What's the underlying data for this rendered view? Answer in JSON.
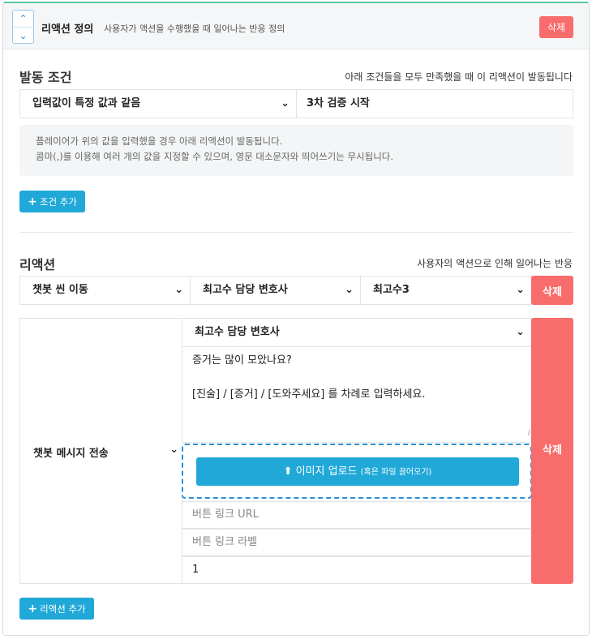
{
  "header": {
    "title": "리액션 정의",
    "description": "사용자가 액션을 수행했을 때 일어나는 반응 정의",
    "delete_label": "삭제"
  },
  "condition": {
    "title": "발동 조건",
    "note": "아래 조건들을 모두 만족했을 때 이 리액션이 발동됩니다",
    "type_select": "입력값이 특정 값과 같음",
    "value_input": "3차 검증 시작",
    "info_line1": "플레이어가 위의 값을 입력했을 경우 아래 리액션이 발동됩니다.",
    "info_line2": "콤마(,)를 이용해 여러 개의 값을 지정할 수 있으며, 영문 대소문자와 띄어쓰기는 무시됩니다.",
    "add_label": "조건 추가"
  },
  "reaction": {
    "title": "리액션",
    "note": "사용자의 액션으로 인해 일어나는 반응",
    "row1": {
      "type": "챗봇 씬 이동",
      "target": "최고수 담당 변호사",
      "scene": "최고수3",
      "delete_label": "삭제"
    },
    "row2": {
      "type": "챗봇 메시지 전송",
      "speaker": "최고수 담당 변호사",
      "message_line1": "증거는 많이 모았나요?",
      "message_line2": "[진술] / [증거] / [도와주세요] 를 차례로 입력하세요.",
      "upload_label": "이미지 업로드",
      "upload_hint": "(혹은 파일 끌어오기)",
      "link_url_placeholder": "버튼 링크 URL",
      "link_label_placeholder": "버튼 링크 라벨",
      "delay_value": "1",
      "delete_label": "삭제"
    },
    "add_label": "리액션 추가"
  }
}
